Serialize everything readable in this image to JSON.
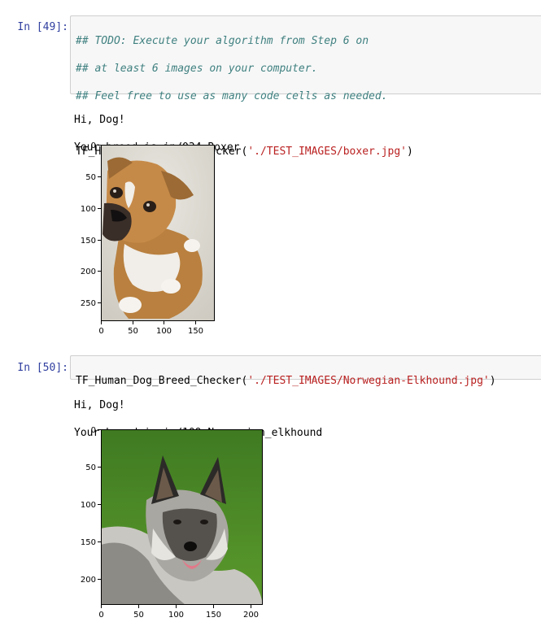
{
  "cells": [
    {
      "prompt": "In [49]:",
      "code_lines": [
        {
          "type": "comment",
          "text": "## TODO: Execute your algorithm from Step 6 on"
        },
        {
          "type": "comment",
          "text": "## at least 6 images on your computer."
        },
        {
          "type": "comment",
          "text": "## Feel free to use as many code cells as needed."
        },
        {
          "type": "blank",
          "text": ""
        }
      ],
      "call": {
        "func": "TF_Human_Dog_Breed_Checker(",
        "arg": "'./TEST_IMAGES/boxer.jpg'",
        "close": ")"
      },
      "output_lines": [
        "Hi, Dog!",
        "Your breed is in/034.Boxer"
      ],
      "image": {
        "subject": "boxer-dog-photo",
        "x_ticks": [
          "0",
          "50",
          "100",
          "150"
        ],
        "y_ticks": [
          "0",
          "50",
          "100",
          "150",
          "200",
          "250"
        ]
      }
    },
    {
      "prompt": "In [50]:",
      "code_lines": [],
      "call": {
        "func": "TF_Human_Dog_Breed_Checker(",
        "arg": "'./TEST_IMAGES/Norwegian-Elkhound.jpg'",
        "close": ")"
      },
      "output_lines": [
        "Hi, Dog!",
        "Your breed is in/109.Norwegian_elkhound"
      ],
      "image": {
        "subject": "norwegian-elkhound-photo",
        "x_ticks": [
          "0",
          "50",
          "100",
          "150",
          "200"
        ],
        "y_ticks": [
          "0",
          "50",
          "100",
          "150",
          "200"
        ]
      }
    }
  ],
  "colors": {
    "prompt": "#303f9f",
    "comment": "#408080",
    "string": "#ba2121",
    "cell_bg": "#f7f7f7",
    "cell_border": "#cfcfcf"
  }
}
